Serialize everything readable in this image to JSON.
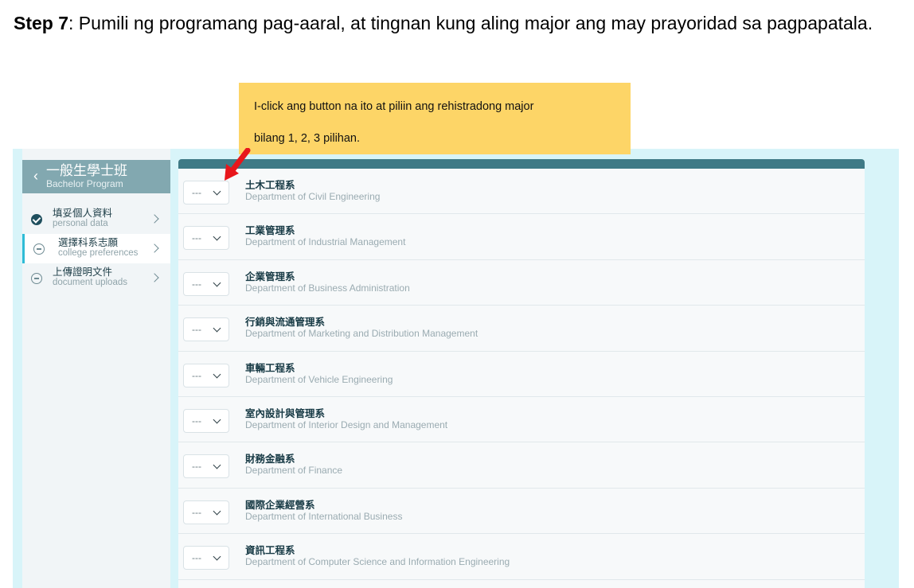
{
  "instruction": {
    "step_label": "Step 7",
    "text": ": Pumili ng programang pag-aaral, at tingnan kung aling major ang may prayoridad sa pagpapatala."
  },
  "callout": {
    "line1": "I-click ang button na ito at piliin ang rehistradong major",
    "line2": "bilang 1, 2, 3 pilihan."
  },
  "sidebar": {
    "back_icon": "chevron-left-icon",
    "title_zh": "一般生學士班",
    "title_en": "Bachelor Program",
    "steps": [
      {
        "zh": "填妥個人資料",
        "en": "personal data",
        "status": "done"
      },
      {
        "zh": "選擇科系志願",
        "en": "college preferences",
        "status": "active"
      },
      {
        "zh": "上傳證明文件",
        "en": "document uploads",
        "status": "todo"
      }
    ]
  },
  "colors": {
    "accent": "#3f7a86",
    "active_indicator": "#2fbcd6",
    "callout_bg": "#fdd567",
    "arrow": "#e8161b"
  },
  "departments": {
    "select_value": "---",
    "items": [
      {
        "zh": "土木工程系",
        "en": "Department of Civil Engineering"
      },
      {
        "zh": "工業管理系",
        "en": "Department of Industrial Management"
      },
      {
        "zh": "企業管理系",
        "en": "Department of Business Administration"
      },
      {
        "zh": "行銷與流通管理系",
        "en": "Department of Marketing and Distribution Management"
      },
      {
        "zh": "車輛工程系",
        "en": "Department of Vehicle Engineering"
      },
      {
        "zh": "室內設計與管理系",
        "en": "Department of Interior Design and Management"
      },
      {
        "zh": "財務金融系",
        "en": "Department of Finance"
      },
      {
        "zh": "國際企業經營系",
        "en": "Department of International Business"
      },
      {
        "zh": "資訊工程系",
        "en": "Department of Computer Science and Information Engineering"
      }
    ]
  }
}
